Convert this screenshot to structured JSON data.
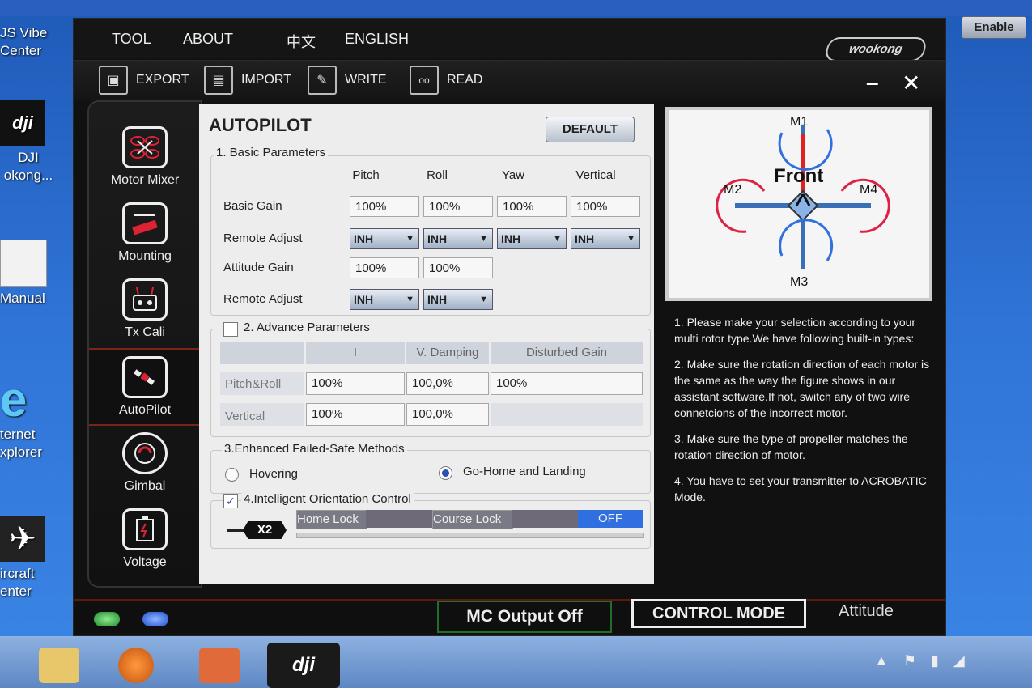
{
  "desktop": {
    "icons": [
      {
        "label": "JS Vibe\nCenter"
      },
      {
        "label": "DJI\nokong..."
      },
      {
        "label": "Manual"
      },
      {
        "label": "ternet\nxplorer"
      },
      {
        "label": "ircraft\nenter"
      }
    ],
    "enable_button": "Enable"
  },
  "menu": {
    "tool": "TOOL",
    "about": "ABOUT",
    "chinese": "中文",
    "english": "ENGLISH"
  },
  "brand": "wookong",
  "toolbar": {
    "export": "EXPORT",
    "import": "IMPORT",
    "write": "WRITE",
    "read": "READ"
  },
  "window_controls": {
    "minimize": "–",
    "close": "✕"
  },
  "sidebar": {
    "items": [
      {
        "label": "Motor Mixer"
      },
      {
        "label": "Mounting"
      },
      {
        "label": "Tx Cali"
      },
      {
        "label": "AutoPilot"
      },
      {
        "label": "Gimbal"
      },
      {
        "label": "Voltage"
      }
    ]
  },
  "main": {
    "title": "AUTOPILOT",
    "default_button": "DEFAULT",
    "basic": {
      "title": "1. Basic Parameters",
      "columns": [
        "Pitch",
        "Roll",
        "Yaw",
        "Vertical"
      ],
      "basic_gain_label": "Basic Gain",
      "basic_gain": [
        "100%",
        "100%",
        "100%",
        "100%"
      ],
      "remote_adjust_label": "Remote Adjust",
      "remote_adjust": [
        "INH",
        "INH",
        "INH",
        "INH"
      ],
      "attitude_gain_label": "Attitude Gain",
      "attitude_gain": [
        "100%",
        "100%"
      ],
      "remote_adjust2_label": "Remote Adjust",
      "remote_adjust2": [
        "INH",
        "INH"
      ]
    },
    "advance": {
      "title": "2. Advance Parameters",
      "columns": [
        "I",
        "V. Damping",
        "Disturbed Gain"
      ],
      "rows": [
        {
          "label": "Pitch&Roll",
          "values": [
            "100%",
            "100,0%",
            "100%"
          ]
        },
        {
          "label": "Vertical",
          "values": [
            "100%",
            "100,0%",
            ""
          ]
        }
      ]
    },
    "failsafe": {
      "title": "3.Enhanced Failed-Safe Methods",
      "option1": "Hovering",
      "option2": "Go-Home and Landing"
    },
    "ioc": {
      "title": "4.Intelligent Orientation Control",
      "switch_label": "X2",
      "home_lock": "Home Lock",
      "course_lock": "Course Lock",
      "off": "OFF"
    }
  },
  "diagram": {
    "front": "Front",
    "m1": "M1",
    "m2": "M2",
    "m3": "M3",
    "m4": "M4"
  },
  "info": [
    "1. Please make your selection according to your multi rotor type.We have following built-in types:",
    "2. Make sure the rotation direction of each motor is the same as the way the figure shows in our assistant software.If not, switch any of two wire connetcions of the incorrect motor.",
    "3. Make sure the type of propeller matches the rotation direction of motor.",
    "4. You have to set your transmitter to ACROBATIC Mode."
  ],
  "status": {
    "mc_output": "MC Output Off",
    "control_mode": "CONTROL MODE",
    "mode_value": "Attitude"
  },
  "colors": {
    "accent_red": "#c0392b",
    "highlight_blue": "#2f6fe0",
    "panel_bg": "#ededed"
  }
}
